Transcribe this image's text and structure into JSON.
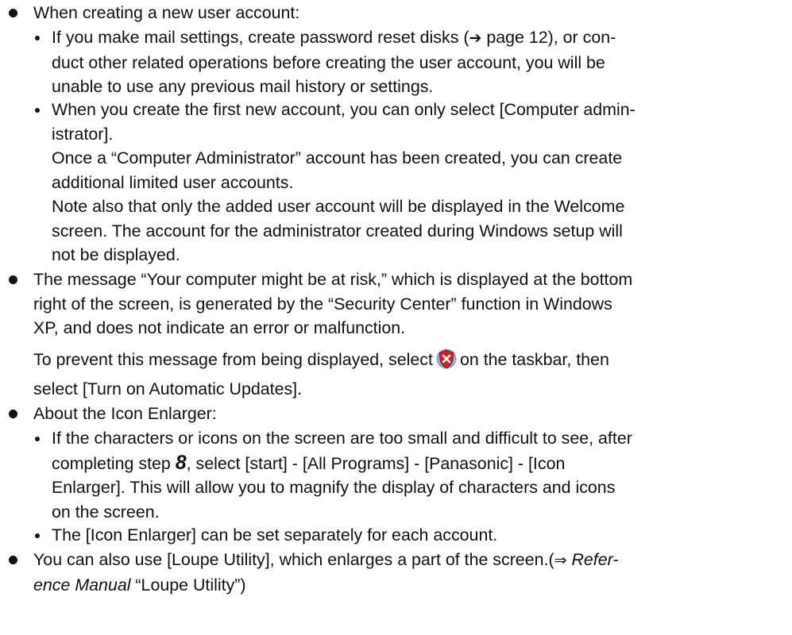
{
  "items": [
    {
      "type": "bullet",
      "text": "When creating a new user account:",
      "subitems": [
        {
          "lines": [
            "If you make mail settings, create password reset disks (",
            " page 12), or con-",
            "duct other related operations before creating the user account, you will be",
            "unable to use any previous mail history or settings."
          ],
          "arrow_symbol": "➔"
        },
        {
          "lines": [
            "When you create the first new account, you can only select [Computer admin-",
            "istrator].",
            "Once a “Computer Administrator” account has been created, you can create",
            "additional limited user accounts.",
            "Note also that only the added user account will be displayed in the Welcome",
            "screen. The account for the administrator created during Windows setup will",
            "not be displayed."
          ]
        }
      ]
    },
    {
      "type": "bullet",
      "lines": [
        "The message “Your computer might be at risk,” which is displayed at the bottom",
        "right of the screen, is generated by the “Security Center” function in Windows",
        "XP, and does not indicate an error or malfunction."
      ],
      "extra_lines": [
        "To prevent this message from being displayed, select",
        "on the taskbar, then",
        "select [Turn on Automatic Updates]."
      ],
      "icon": "security-center-shield-icon",
      "icon_colors": {
        "shield": "#d11f2a",
        "cross": "#ffffff",
        "ring": "#7f9fcf"
      }
    },
    {
      "type": "bullet",
      "text": "About the Icon Enlarger:",
      "subitems": [
        {
          "lines": [
            "If the characters or icons on the screen are too small and difficult to see, after",
            "completing step ",
            "8",
            ", select [start] - [All Programs] - [Panasonic] - [Icon",
            "Enlarger].  This will allow you to magnify the display of characters and icons",
            "on the screen."
          ]
        },
        {
          "lines": [
            "The [Icon Enlarger] can be set separately for each account."
          ]
        }
      ]
    },
    {
      "type": "bullet",
      "lines": [
        "You can also use [Loupe Utility], which enlarges a part of the screen.(",
        "⇒",
        " Refer-",
        "ence Manual",
        " “Loupe Utility”)"
      ]
    }
  ]
}
